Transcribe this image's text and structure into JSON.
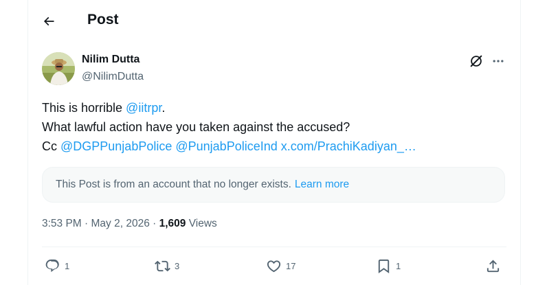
{
  "header": {
    "title": "Post"
  },
  "author": {
    "name": "Nilim Dutta",
    "handle": "@NilimDutta"
  },
  "post": {
    "line1": {
      "text": "This is horrible ",
      "mention": "@iitrpr",
      "end": "."
    },
    "line2": {
      "text": "What lawful action have you taken against the accused?"
    },
    "line3": {
      "prefix": "Cc ",
      "mention1": "@DGPPunjabPolice",
      "mention2": "@PunjabPoliceInd",
      "link": "x.com/PrachiKadiyan_…"
    }
  },
  "notice": {
    "text": "This Post is from an account that no longer exists.",
    "link": "Learn more"
  },
  "meta": {
    "time": "3:53 PM",
    "date": "May 2, 2026",
    "separator": " · ",
    "views_count": "1,609",
    "views_label": "Views"
  },
  "actions": {
    "replies": "1",
    "reposts": "3",
    "likes": "17",
    "bookmarks": "1"
  },
  "colors": {
    "accent": "#1d9bf0",
    "text": "#0f1419",
    "secondary": "#536471",
    "border": "#eff3f4",
    "notice_bg": "#f7f9f9"
  },
  "icons": [
    "back-arrow-icon",
    "grok-icon",
    "more-icon",
    "reply-icon",
    "repost-icon",
    "like-icon",
    "bookmark-icon",
    "share-icon"
  ]
}
